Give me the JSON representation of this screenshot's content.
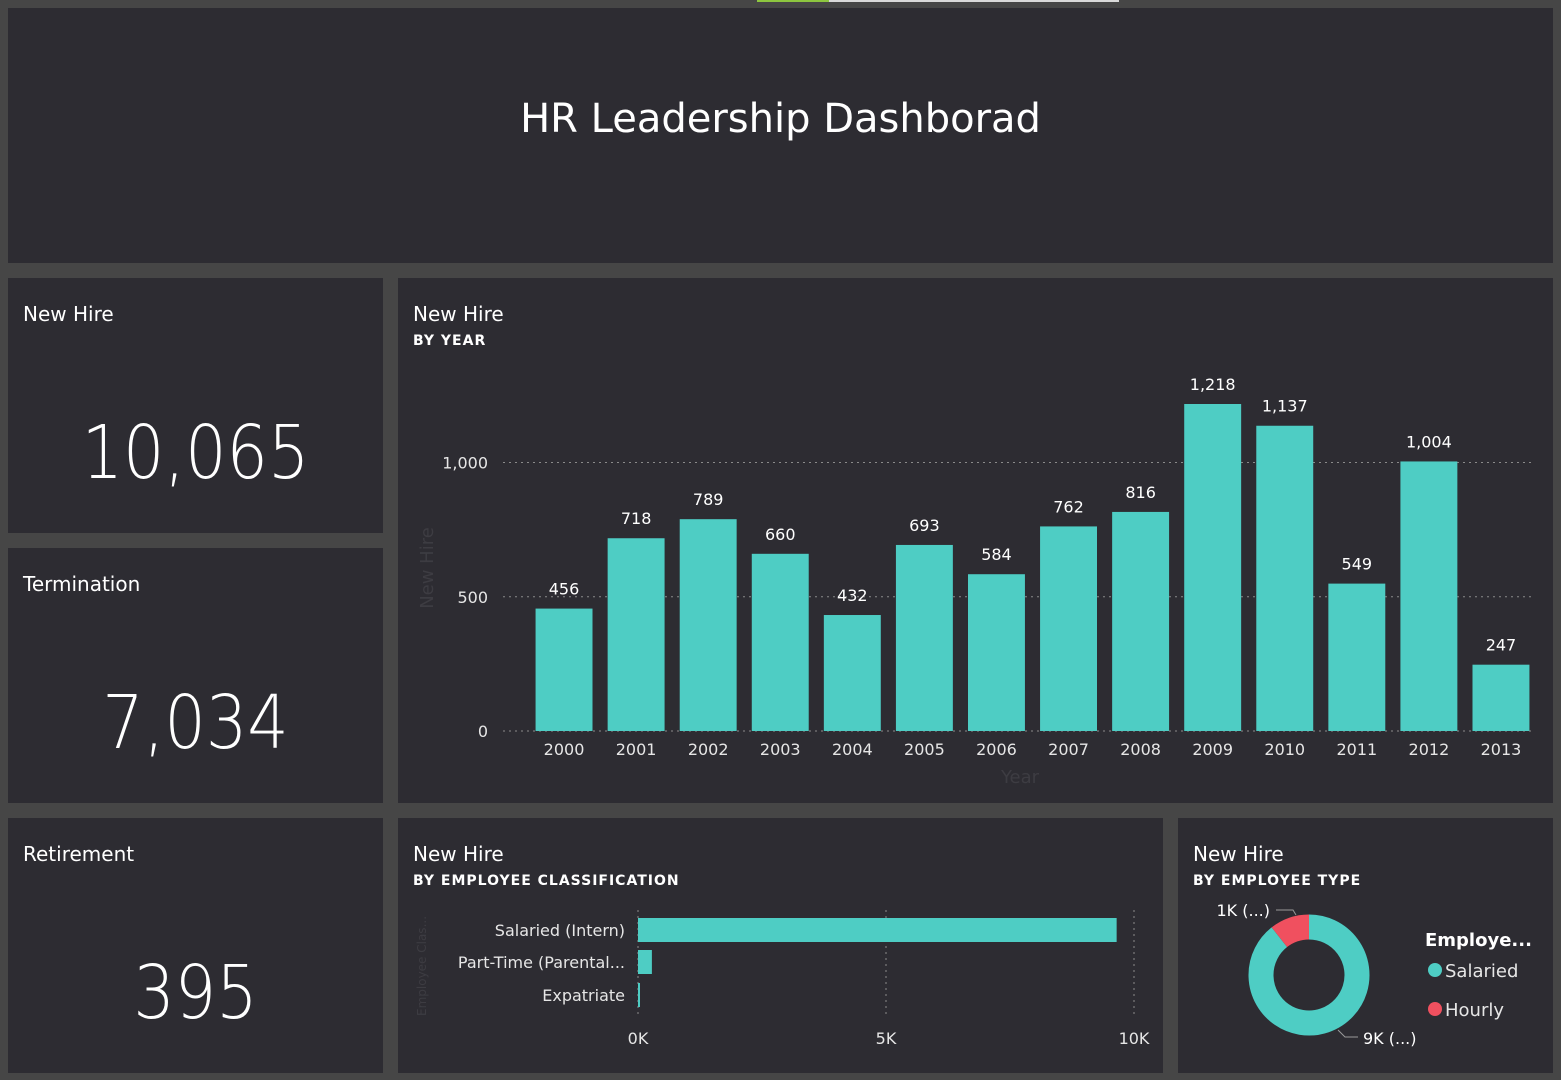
{
  "progress": {
    "fraction": 0.2
  },
  "header": {
    "title": "HR Leadership Dashborad"
  },
  "kpis": {
    "new_hire": {
      "label": "New Hire",
      "value": "10,065"
    },
    "termination": {
      "label": "Termination",
      "value": "7,034"
    },
    "retirement": {
      "label": "Retirement",
      "value": "395"
    }
  },
  "colors": {
    "accent": "#4ecdc4",
    "hourly": "#f0505f",
    "tile_bg": "#2d2c32",
    "page_bg": "#464646"
  },
  "year_chart": {
    "title": "New Hire",
    "subtitle": "BY YEAR",
    "chart_data": {
      "type": "bar",
      "categories": [
        "2000",
        "2001",
        "2002",
        "2003",
        "2004",
        "2005",
        "2006",
        "2007",
        "2008",
        "2009",
        "2010",
        "2011",
        "2012",
        "2013"
      ],
      "values": [
        456,
        718,
        789,
        660,
        432,
        693,
        584,
        762,
        816,
        1218,
        1137,
        549,
        1004,
        247
      ],
      "value_labels": [
        "456",
        "718",
        "789",
        "660",
        "432",
        "693",
        "584",
        "762",
        "816",
        "1,218",
        "1,137",
        "549",
        "1,004",
        "247"
      ],
      "ylim": [
        0,
        1218
      ],
      "yticks": [
        0,
        500,
        1000
      ],
      "ytick_labels": [
        "0",
        "500",
        "1,000"
      ],
      "xlabel": "Year",
      "ylabel": "New Hire",
      "grid": true
    }
  },
  "class_chart": {
    "title": "New Hire",
    "subtitle": "BY EMPLOYEE CLASSIFICATION",
    "chart_data": {
      "type": "bar",
      "orientation": "horizontal",
      "categories": [
        "Salaried (Intern)",
        "Part-Time (Parental...",
        "Expatriate"
      ],
      "values": [
        9650,
        280,
        40
      ],
      "xlim": [
        0,
        10000
      ],
      "xticks": [
        0,
        5000,
        10000
      ],
      "xtick_labels": [
        "0K",
        "5K",
        "10K"
      ],
      "ylabel": "Employee Clas...",
      "grid": true
    }
  },
  "type_chart": {
    "title": "New Hire",
    "subtitle": "BY EMPLOYEE TYPE",
    "chart_data": {
      "type": "pie",
      "donut": true,
      "labels": [
        "Salaried",
        "Hourly"
      ],
      "values": [
        9000,
        1065
      ],
      "slice_labels": [
        "9K (...)",
        "1K (...)"
      ],
      "legend_title": "Employe...",
      "legend_position": "right"
    }
  }
}
